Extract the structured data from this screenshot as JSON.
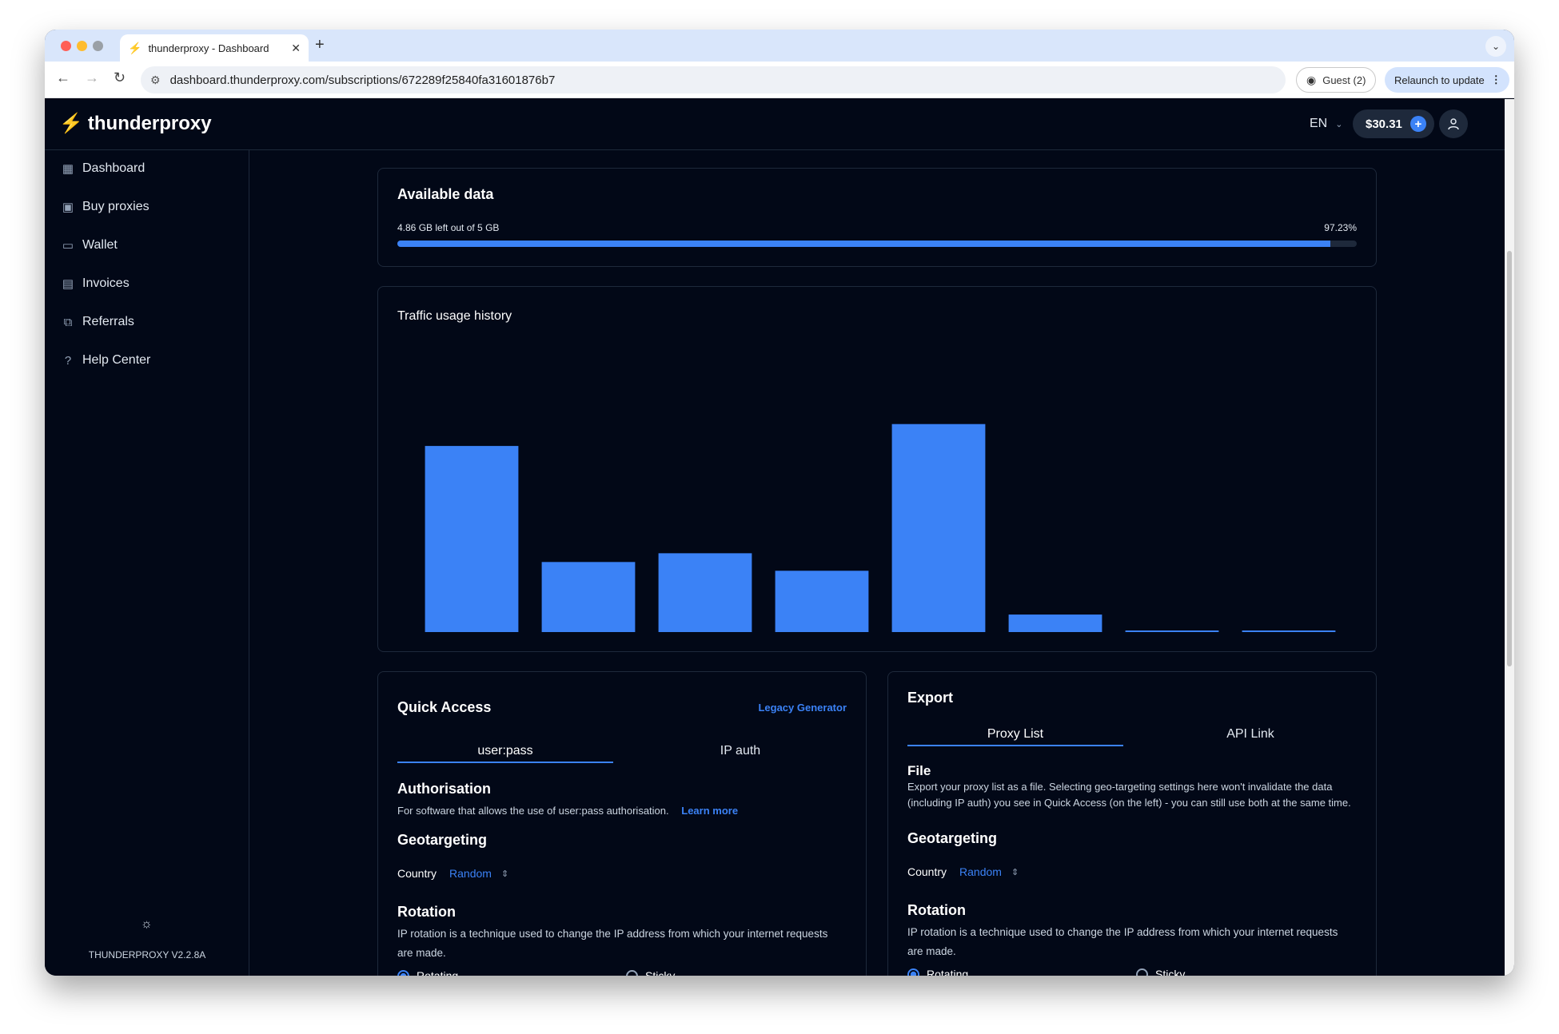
{
  "browser": {
    "tab_title": "thunderproxy - Dashboard",
    "url": "dashboard.thunderproxy.com/subscriptions/672289f25840fa31601876b7",
    "guest_label": "Guest (2)",
    "relaunch_label": "Relaunch to update"
  },
  "header": {
    "brand": "thunderproxy",
    "language": "EN",
    "balance": "$30.31"
  },
  "sidebar": {
    "items": [
      {
        "label": "Dashboard",
        "icon": "dashboard-icon"
      },
      {
        "label": "Buy proxies",
        "icon": "shopping-bag-icon"
      },
      {
        "label": "Wallet",
        "icon": "wallet-icon"
      },
      {
        "label": "Invoices",
        "icon": "invoice-icon"
      },
      {
        "label": "Referrals",
        "icon": "referrals-icon"
      },
      {
        "label": "Help Center",
        "icon": "help-icon"
      }
    ],
    "version": "THUNDERPROXY V2.2.8A"
  },
  "available_data": {
    "title": "Available data",
    "summary": "4.86 GB left out of 5 GB",
    "percent_label": "97.23%",
    "percent": 97.23
  },
  "traffic": {
    "title": "Traffic usage history"
  },
  "chart_data": {
    "type": "bar",
    "title": "Traffic usage history",
    "values": [
      0.85,
      0.32,
      0.36,
      0.28,
      0.95,
      0.08,
      0.003,
      0.003
    ],
    "ylim": [
      0,
      1
    ],
    "bar_color": "#3b82f6",
    "grid": false
  },
  "quick_access": {
    "title": "Quick Access",
    "legacy_link": "Legacy Generator",
    "tabs": [
      "user:pass",
      "IP auth"
    ],
    "auth_title": "Authorisation",
    "auth_text": "For software that allows the use of user:pass authorisation.",
    "learn_more": "Learn more",
    "geo_title": "Geotargeting",
    "country_label": "Country",
    "country_value": "Random",
    "rotation_title": "Rotation",
    "rotation_text": "IP rotation is a technique used to change the IP address from which your internet requests are made.",
    "rotating": "Rotating",
    "sticky": "Sticky"
  },
  "export": {
    "title": "Export",
    "tabs": [
      "Proxy List",
      "API Link"
    ],
    "file_title": "File",
    "file_text": "Export your proxy list as a file. Selecting geo-targeting settings here won't invalidate the data (including IP auth) you see in Quick Access (on the left) - you can still use both at the same time.",
    "geo_title": "Geotargeting",
    "country_label": "Country",
    "country_value": "Random",
    "rotation_title": "Rotation",
    "rotation_text": "IP rotation is a technique used to change the IP address from which your internet requests are made.",
    "rotating": "Rotating",
    "sticky": "Sticky"
  }
}
